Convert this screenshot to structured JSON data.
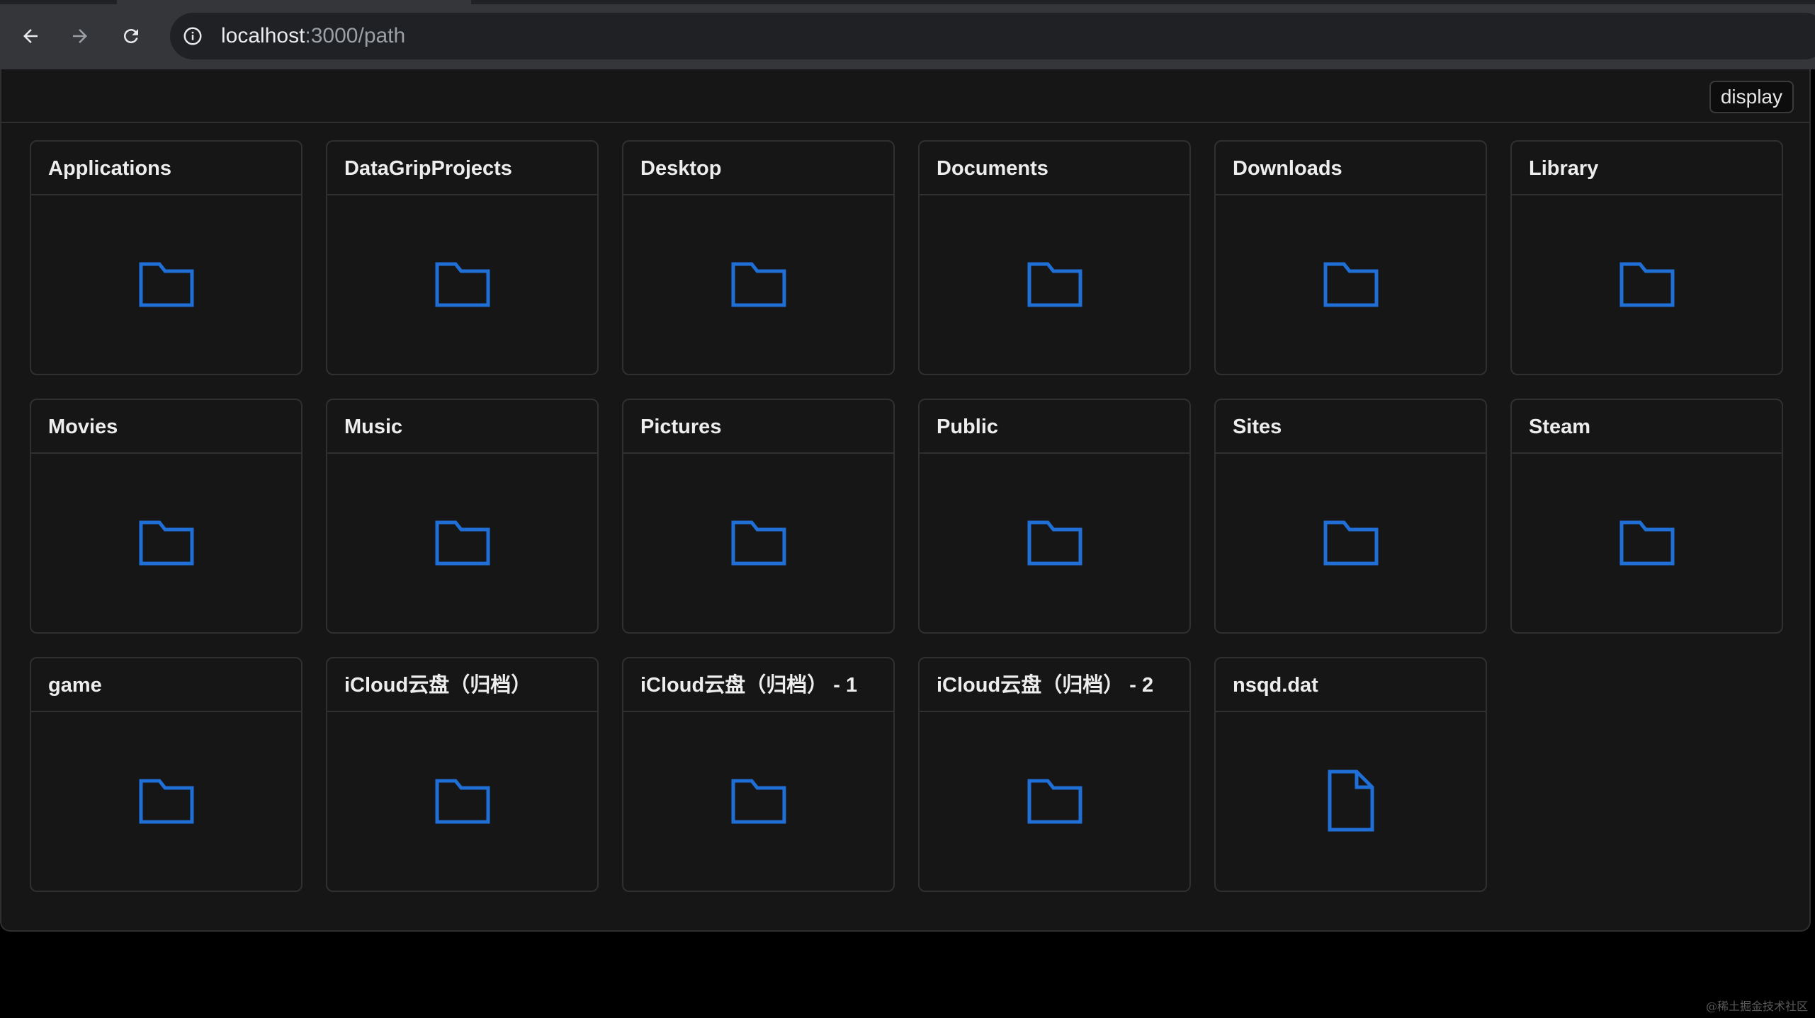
{
  "browser": {
    "url_host": "localhost",
    "url_path": ":3000/path"
  },
  "toolbar": {
    "display_label": "display"
  },
  "items": [
    {
      "name": "Applications",
      "type": "folder"
    },
    {
      "name": "DataGripProjects",
      "type": "folder"
    },
    {
      "name": "Desktop",
      "type": "folder"
    },
    {
      "name": "Documents",
      "type": "folder"
    },
    {
      "name": "Downloads",
      "type": "folder"
    },
    {
      "name": "Library",
      "type": "folder"
    },
    {
      "name": "Movies",
      "type": "folder"
    },
    {
      "name": "Music",
      "type": "folder"
    },
    {
      "name": "Pictures",
      "type": "folder"
    },
    {
      "name": "Public",
      "type": "folder"
    },
    {
      "name": "Sites",
      "type": "folder"
    },
    {
      "name": "Steam",
      "type": "folder"
    },
    {
      "name": "game",
      "type": "folder"
    },
    {
      "name": "iCloud云盘（归档）",
      "type": "folder"
    },
    {
      "name": "iCloud云盘（归档） - 1",
      "type": "folder"
    },
    {
      "name": "iCloud云盘（归档） - 2",
      "type": "folder"
    },
    {
      "name": "nsqd.dat",
      "type": "file"
    }
  ],
  "icons": {
    "folder": "folder-icon",
    "file": "file-icon"
  },
  "colors": {
    "icon_blue": "#1f6fd6"
  },
  "watermark": "@稀土掘金技术社区"
}
